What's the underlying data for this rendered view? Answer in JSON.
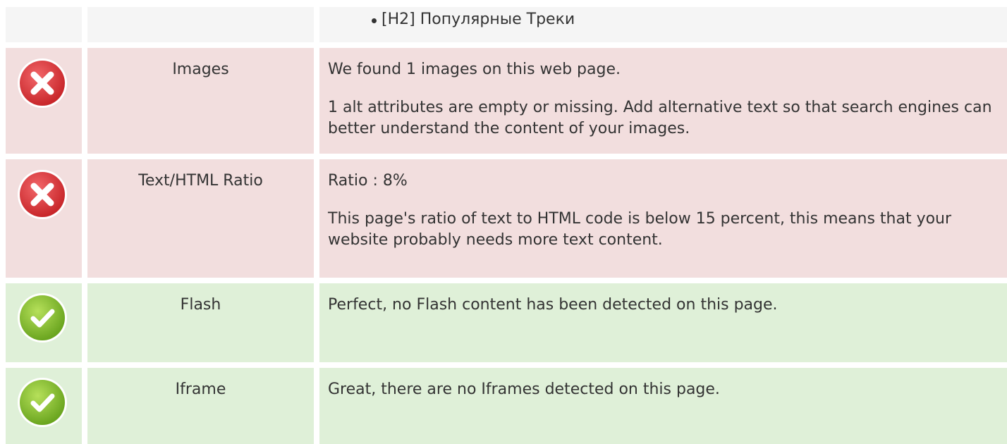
{
  "top_row": {
    "list_item": "[H2] Популярные Треки"
  },
  "rows": [
    {
      "status": "error",
      "label": "Images",
      "paragraphs": [
        "We found 1 images on this web page.",
        "1 alt attributes are empty or missing. Add alternative text so that search engines can better understand the content of your images."
      ]
    },
    {
      "status": "error",
      "label": "Text/HTML Ratio",
      "paragraphs": [
        "Ratio : 8%",
        "This page's ratio of text to HTML code is below 15 percent, this means that your website probably needs more text content."
      ]
    },
    {
      "status": "ok",
      "label": "Flash",
      "paragraphs": [
        "Perfect, no Flash content has been detected on this page."
      ]
    },
    {
      "status": "ok",
      "label": "Iframe",
      "paragraphs": [
        "Great, there are no Iframes detected on this page."
      ]
    }
  ],
  "icons": {
    "error": "error-x-icon",
    "ok": "success-check-icon"
  },
  "colors": {
    "error_row": "#f2dede",
    "ok_row": "#dff0d8",
    "neutral_row": "#f5f5f5",
    "error_icon": "#e0393c",
    "ok_icon": "#8cc63f"
  }
}
